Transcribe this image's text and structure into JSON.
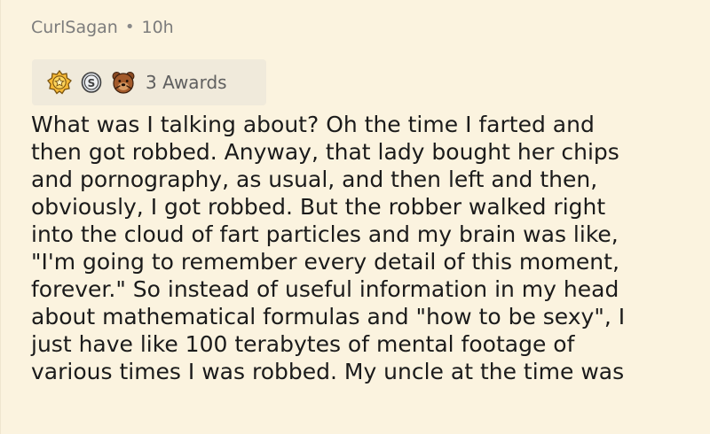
{
  "comment": {
    "author": "CurlSagan",
    "separator": "•",
    "timestamp": "10h",
    "awards": {
      "icons": [
        "gold-star-award-icon",
        "silver-s-coin-award-icon",
        "bear-face-award-icon"
      ],
      "count_label": "3 Awards"
    },
    "body_lines": [
      "What was I talking about? Oh the time I farted and",
      "then got robbed. Anyway, that lady bought her chips",
      "and pornography, as usual, and then left and then,",
      "obviously, I got robbed. But the robber walked right",
      "into the cloud of fart particles and my brain was like,",
      "\"I'm going to remember every detail of this moment,",
      "forever.\" So instead of useful information in my head",
      "about mathematical formulas and \"how to be sexy\", I",
      "just have like 100 terabytes of mental footage of",
      "various times I was robbed. My uncle at the time was"
    ]
  },
  "colors": {
    "background": "#fbf3df",
    "awards_background": "#f0eadb",
    "meta_text": "#7c7c7c",
    "body_text": "#1b1b1b"
  }
}
